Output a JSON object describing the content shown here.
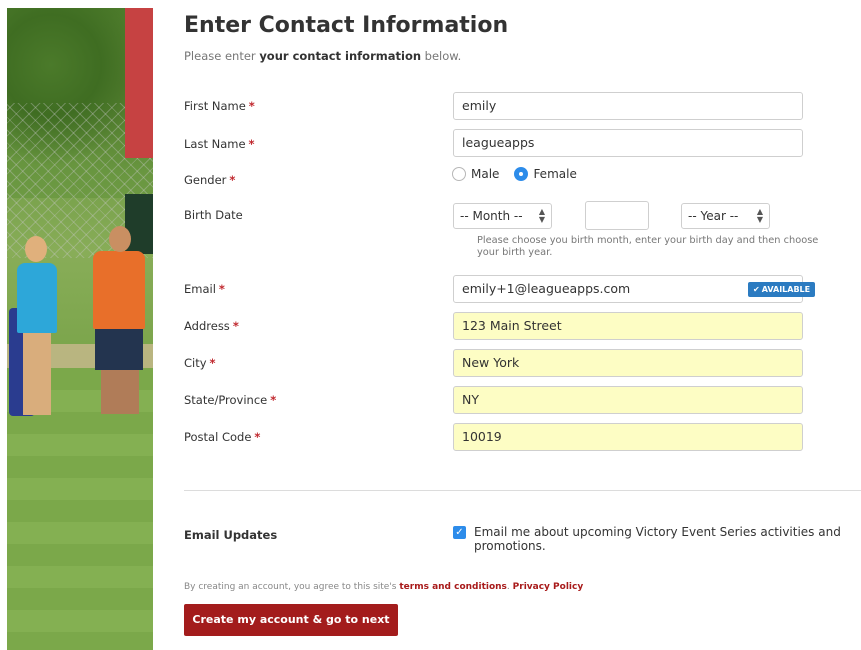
{
  "header": {
    "title": "Enter Contact Information",
    "subtitle_pre": "Please enter ",
    "subtitle_bold": "your contact information",
    "subtitle_post": " below."
  },
  "fields": {
    "first_name": {
      "label": "First Name",
      "required": "*",
      "value": "emily"
    },
    "last_name": {
      "label": "Last Name",
      "required": "*",
      "value": "leagueapps"
    },
    "gender": {
      "label": "Gender",
      "required": "*",
      "options": [
        "Male",
        "Female"
      ],
      "selected": "Female"
    },
    "birth_date": {
      "label": "Birth Date",
      "month_placeholder": "-- Month --",
      "year_placeholder": "-- Year --",
      "hint": "Please choose you birth month, enter your birth day and then choose your birth year."
    },
    "email": {
      "label": "Email",
      "required": "*",
      "value": "emily+1@leagueapps.com",
      "badge": "AVAILABLE"
    },
    "address": {
      "label": "Address",
      "required": "*",
      "value": "123 Main Street"
    },
    "city": {
      "label": "City",
      "required": "*",
      "value": "New York"
    },
    "state": {
      "label": "State/Province",
      "required": "*",
      "value": "NY"
    },
    "postal": {
      "label": "Postal Code",
      "required": "*",
      "value": "10019"
    }
  },
  "updates": {
    "label": "Email Updates",
    "checkbox_text": "Email me about upcoming Victory Event Series activities and promotions.",
    "checked": true
  },
  "terms": {
    "pre": "By creating an account, you agree to this site's ",
    "link1": "terms and conditions",
    "sep": ". ",
    "link2": "Privacy Policy"
  },
  "submit_label": "Create my account & go to next step",
  "colors": {
    "accent_red": "#a31c1c",
    "required_red": "#c0282e",
    "selected_blue": "#2d8cea",
    "autofill_yellow": "#fdfdc4"
  },
  "icons": {
    "badge_icon": "checkmark-icon",
    "select_icon": "updown-arrows-icon"
  }
}
